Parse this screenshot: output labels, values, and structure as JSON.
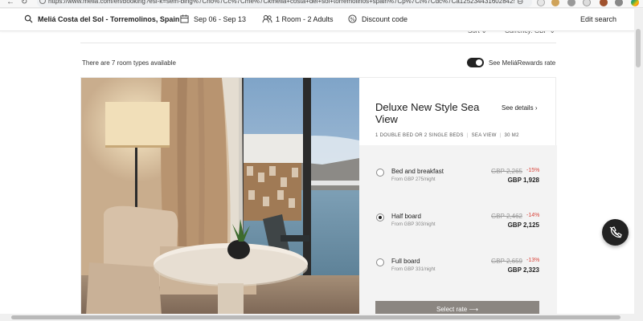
{
  "browser": {
    "url": "https://www.melia.com/en/booking?esl-k=sem-bing%7Cno%7Cc%7Cme%7Ckmelia+costa+del+sol+torremolinos+spain%7Cp%7Ct%7Cdc%7Ca1252344316028425%7Cg3778157..."
  },
  "header": {
    "hotel": "Meliá Costa del Sol - Torremolinos, Spain",
    "dates": "Sep 06 - Sep 13",
    "guests": "1 Room - 2 Adults",
    "discount": "Discount code",
    "edit": "Edit search"
  },
  "toolbar": {
    "sort": "Sort",
    "currency": "Currency: GBP"
  },
  "results": {
    "available": "There are 7 room types available",
    "rewards_label": "See MeliáRewards rate",
    "rewards_on": true
  },
  "room": {
    "title": "Deluxe New Style Sea View",
    "see_details": "See details",
    "features": [
      "1 DOUBLE BED OR 2 SINGLE BEDS",
      "SEA VIEW",
      "30 M2"
    ],
    "options": [
      {
        "name": "Bed and breakfast",
        "sub": "From GBP 275/night",
        "old_price": "GBP 2,265",
        "discount": "-15%",
        "price": "GBP 1,928",
        "selected": false
      },
      {
        "name": "Half board",
        "sub": "From GBP 303/night",
        "old_price": "GBP 2,462",
        "discount": "-14%",
        "price": "GBP 2,125",
        "selected": true
      },
      {
        "name": "Full board",
        "sub": "From GBP 331/night",
        "old_price": "GBP 2,659",
        "discount": "-13%",
        "price": "GBP 2,323",
        "selected": false
      }
    ],
    "select_label": "Select rate"
  },
  "colors": {
    "discount": "#d9463d",
    "button": "#8b8681",
    "fab": "#222222"
  }
}
